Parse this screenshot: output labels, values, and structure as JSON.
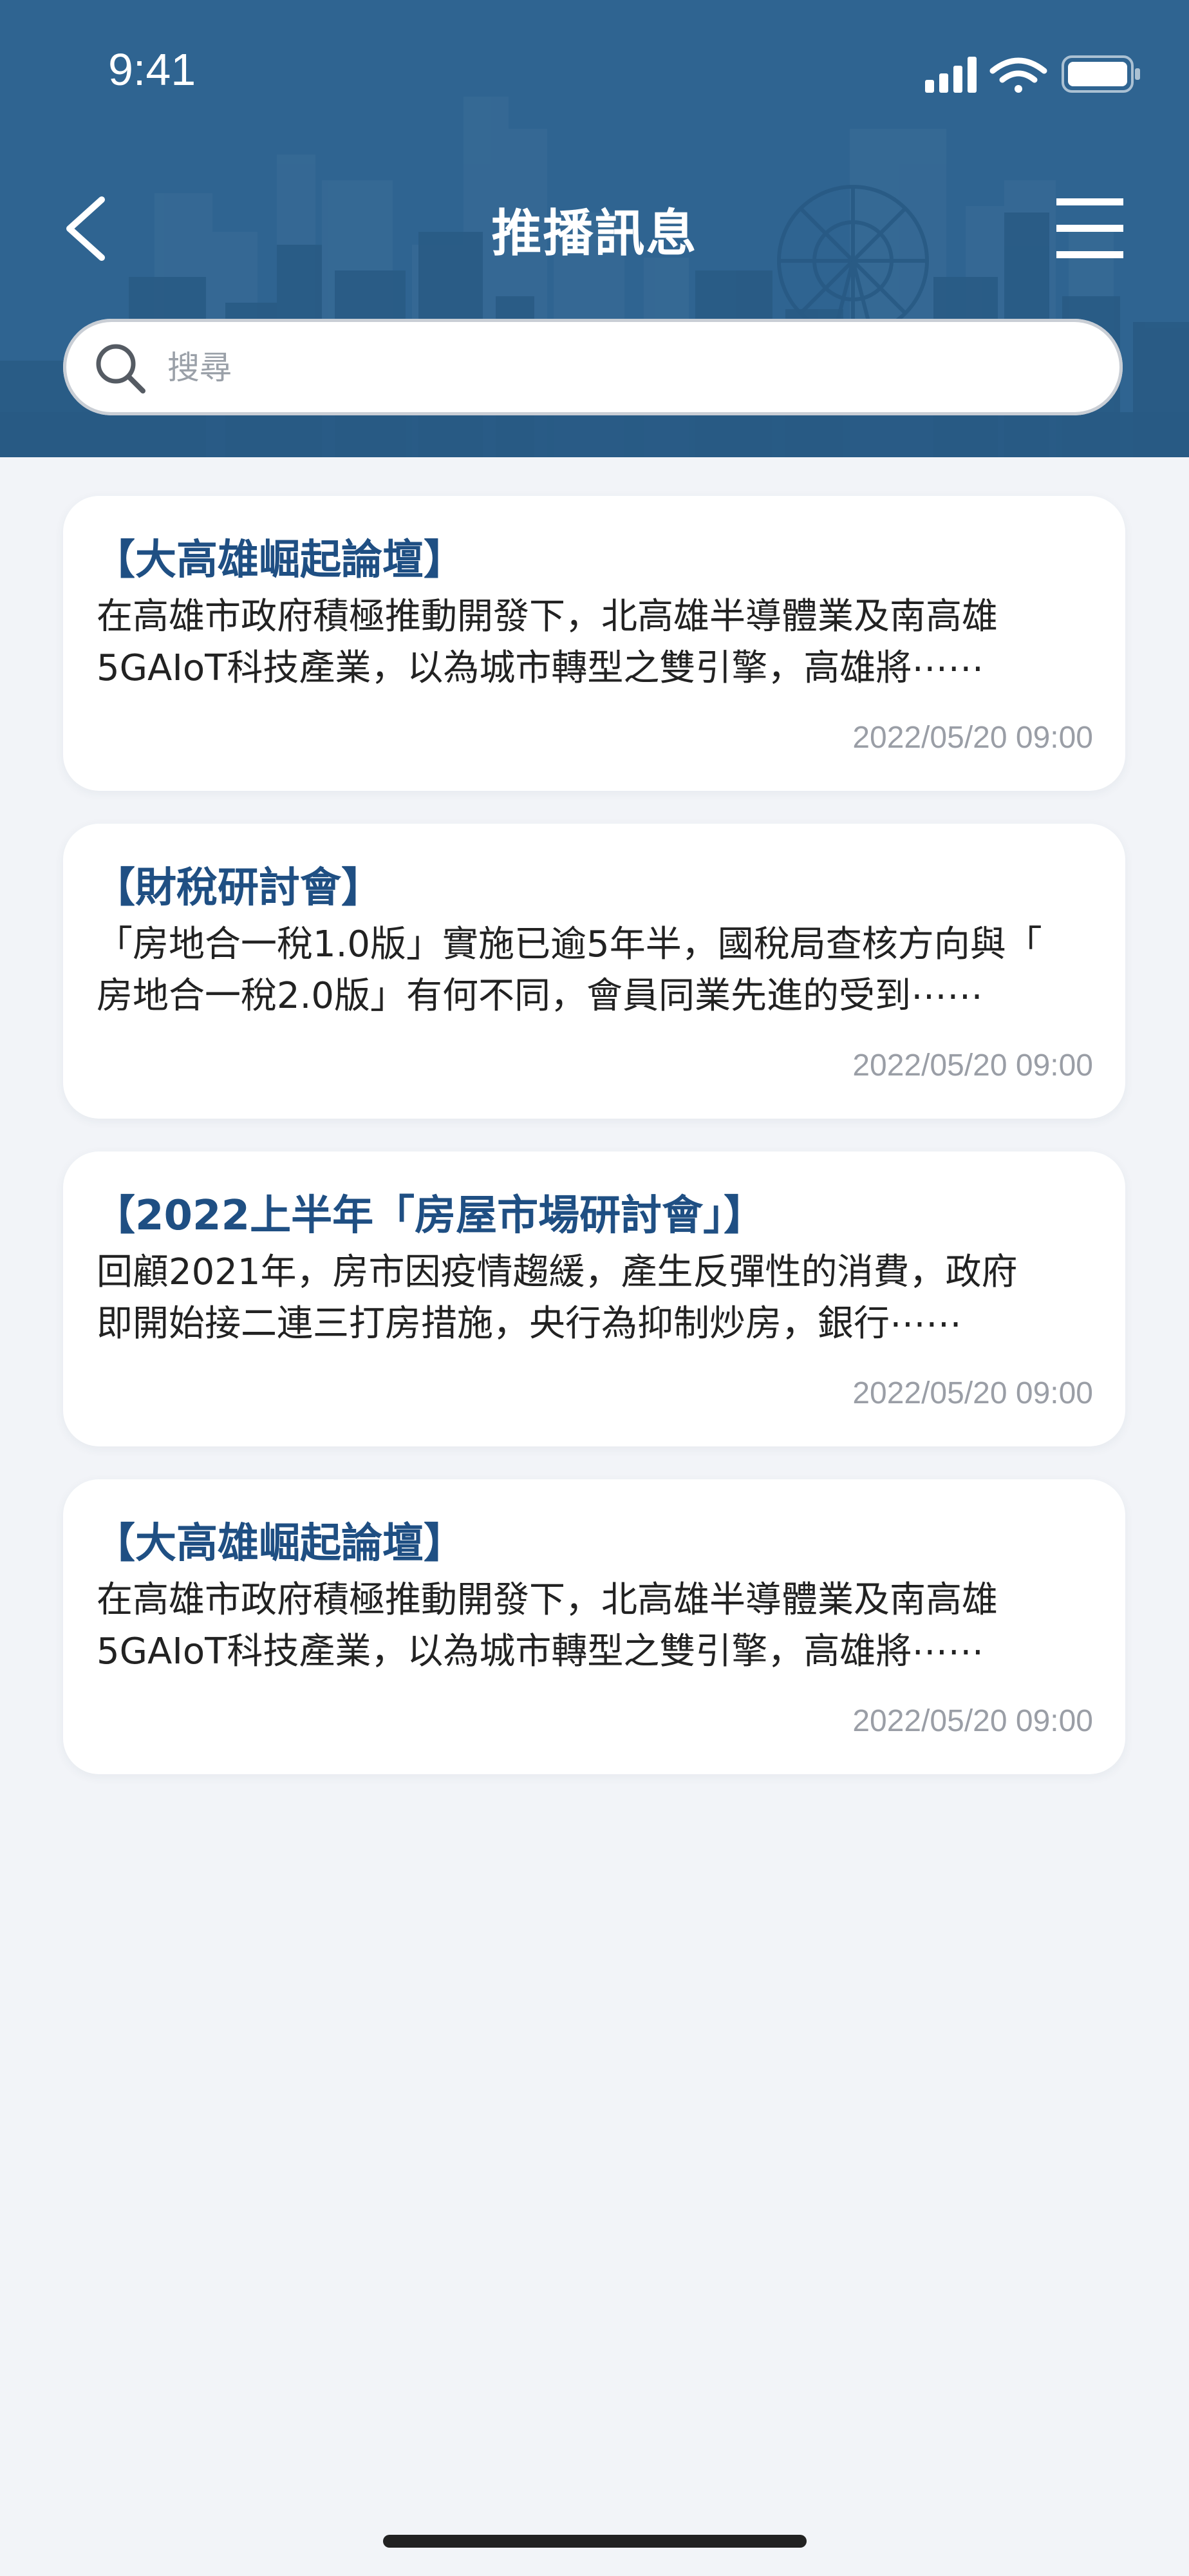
{
  "status_bar": {
    "time": "9:41"
  },
  "header": {
    "title": "推播訊息"
  },
  "search": {
    "placeholder": "搜尋"
  },
  "messages": [
    {
      "title": "【大高雄崛起論壇】",
      "body_line1": "在高雄市政府積極推動開發下，北高雄半導體業及南高雄",
      "body_line2": "5GAIoT科技產業，以為城市轉型之雙引擎，高雄將⋯⋯",
      "timestamp": "2022/05/20 09:00"
    },
    {
      "title": "【財稅研討會】",
      "body_line1": "「房地合一稅1.0版」實施已逾5年半，國稅局查核方向與「",
      "body_line2": "房地合一稅2.0版」有何不同，會員同業先進的受到⋯⋯",
      "timestamp": "2022/05/20 09:00"
    },
    {
      "title": "【2022上半年「房屋市場研討會」】",
      "body_line1": "回顧2021年，房市因疫情趨緩，產生反彈性的消費，政府",
      "body_line2": "即開始接二連三打房措施，央行為抑制炒房，銀行⋯⋯",
      "timestamp": "2022/05/20 09:00"
    },
    {
      "title": "【大高雄崛起論壇】",
      "body_line1": "在高雄市政府積極推動開發下，北高雄半導體業及南高雄",
      "body_line2": "5GAIoT科技產業，以為城市轉型之雙引擎，高雄將⋯⋯",
      "timestamp": "2022/05/20 09:00"
    }
  ],
  "colors": {
    "header_bg": "#2f6491",
    "page_bg": "#f2f4f8",
    "title_blue": "#1f4f83",
    "timestamp_gray": "#9a9ea6"
  },
  "icons": {
    "back": "chevron-left-icon",
    "menu": "hamburger-menu-icon",
    "search": "search-icon",
    "signal": "cellular-signal-icon",
    "wifi": "wifi-icon",
    "battery": "battery-icon"
  }
}
